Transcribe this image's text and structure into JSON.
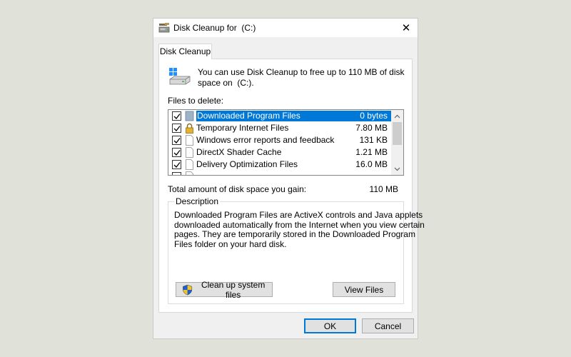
{
  "window": {
    "title": "Disk Cleanup for  (C:)",
    "close_glyph": "✕",
    "title_icon": "disk-cleanup-icon"
  },
  "tabs": [
    {
      "label": "Disk Cleanup"
    }
  ],
  "intro": {
    "text": "You can use Disk Cleanup to free up to 110 MB of disk\nspace on  (C:).",
    "icon": "drive-icon"
  },
  "files": {
    "label": "Files to delete:",
    "items": [
      {
        "name": "Downloaded Program Files",
        "size": "0 bytes",
        "checked": true,
        "selected": true,
        "icon": "folder-icon"
      },
      {
        "name": "Temporary Internet Files",
        "size": "7.80 MB",
        "checked": true,
        "selected": false,
        "icon": "lock-icon"
      },
      {
        "name": "Windows error reports and feedback di...",
        "size": "131 KB",
        "checked": true,
        "selected": false,
        "icon": "file-icon"
      },
      {
        "name": "DirectX Shader Cache",
        "size": "1.21 MB",
        "checked": true,
        "selected": false,
        "icon": "file-icon"
      },
      {
        "name": "Delivery Optimization Files",
        "size": "16.0 MB",
        "checked": true,
        "selected": false,
        "icon": "file-icon"
      }
    ]
  },
  "total": {
    "label": "Total amount of disk space you gain:",
    "value": "110 MB"
  },
  "description": {
    "legend": "Description",
    "text": "Downloaded Program Files are ActiveX controls and Java applets\ndownloaded automatically from the Internet when you view certain\npages. They are temporarily stored in the Downloaded Program\nFiles folder on your hard disk."
  },
  "buttons": {
    "cleanup_system": "Clean up system files",
    "view_files": "View Files",
    "ok": "OK",
    "cancel": "Cancel"
  },
  "colors": {
    "selection": "#0078d7",
    "background": "#e0e2da",
    "dialog": "#f0f0f0"
  }
}
